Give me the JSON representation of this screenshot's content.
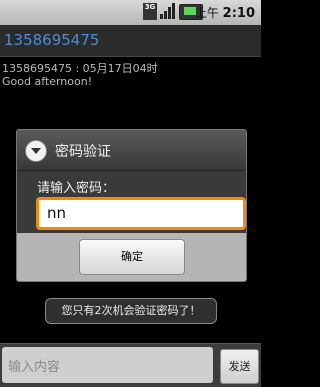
{
  "status_bar": {
    "network_label": "3G",
    "time_prefix": "上午",
    "time": "2:10"
  },
  "header": {
    "title": "1358695475"
  },
  "message": {
    "meta": "1358695475 : 05月17日04时",
    "text": "Good afternoon!"
  },
  "dialog": {
    "title": "密码验证",
    "prompt": "请输入密码：",
    "input_value": "nn",
    "confirm_label": "确定"
  },
  "toast": {
    "text": "您只有2次机会验证密码了！"
  },
  "compose": {
    "placeholder": "输入内容",
    "send_label": "发送"
  }
}
